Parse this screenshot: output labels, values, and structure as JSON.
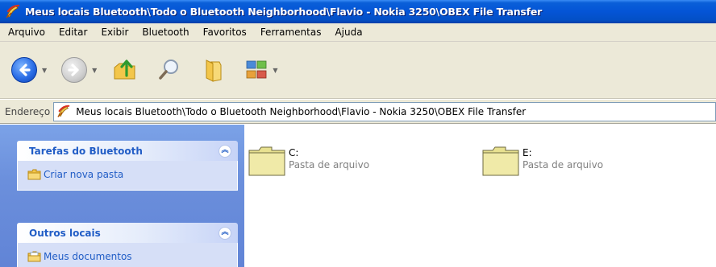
{
  "window": {
    "title": "Meus locais Bluetooth\\Todo o Bluetooth Neighborhood\\Flavio - Nokia 3250\\OBEX File Transfer"
  },
  "menu": {
    "items": [
      "Arquivo",
      "Editar",
      "Exibir",
      "Bluetooth",
      "Favoritos",
      "Ferramentas",
      "Ajuda"
    ]
  },
  "toolbar": {
    "icons": [
      "back-icon",
      "forward-icon",
      "up-folder-icon",
      "search-icon",
      "folders-icon",
      "views-icon"
    ]
  },
  "address": {
    "label": "Endereço",
    "value": "Meus locais Bluetooth\\Todo o Bluetooth Neighborhood\\Flavio - Nokia 3250\\OBEX File Transfer"
  },
  "tasks": {
    "panels": [
      {
        "title": "Tarefas do Bluetooth",
        "links": [
          "Criar nova pasta"
        ]
      },
      {
        "title": "Outros locais",
        "links": [
          "Meus documentos"
        ]
      }
    ]
  },
  "files": [
    {
      "name": "C:",
      "type": "Pasta de arquivo"
    },
    {
      "name": "E:",
      "type": "Pasta de arquivo"
    }
  ],
  "colors": {
    "titlebar": "#0454d6",
    "chrome": "#ece9d8",
    "taskpane": "#6b8fdc",
    "panel_title": "#215dc6",
    "folder": "#e8e190"
  }
}
